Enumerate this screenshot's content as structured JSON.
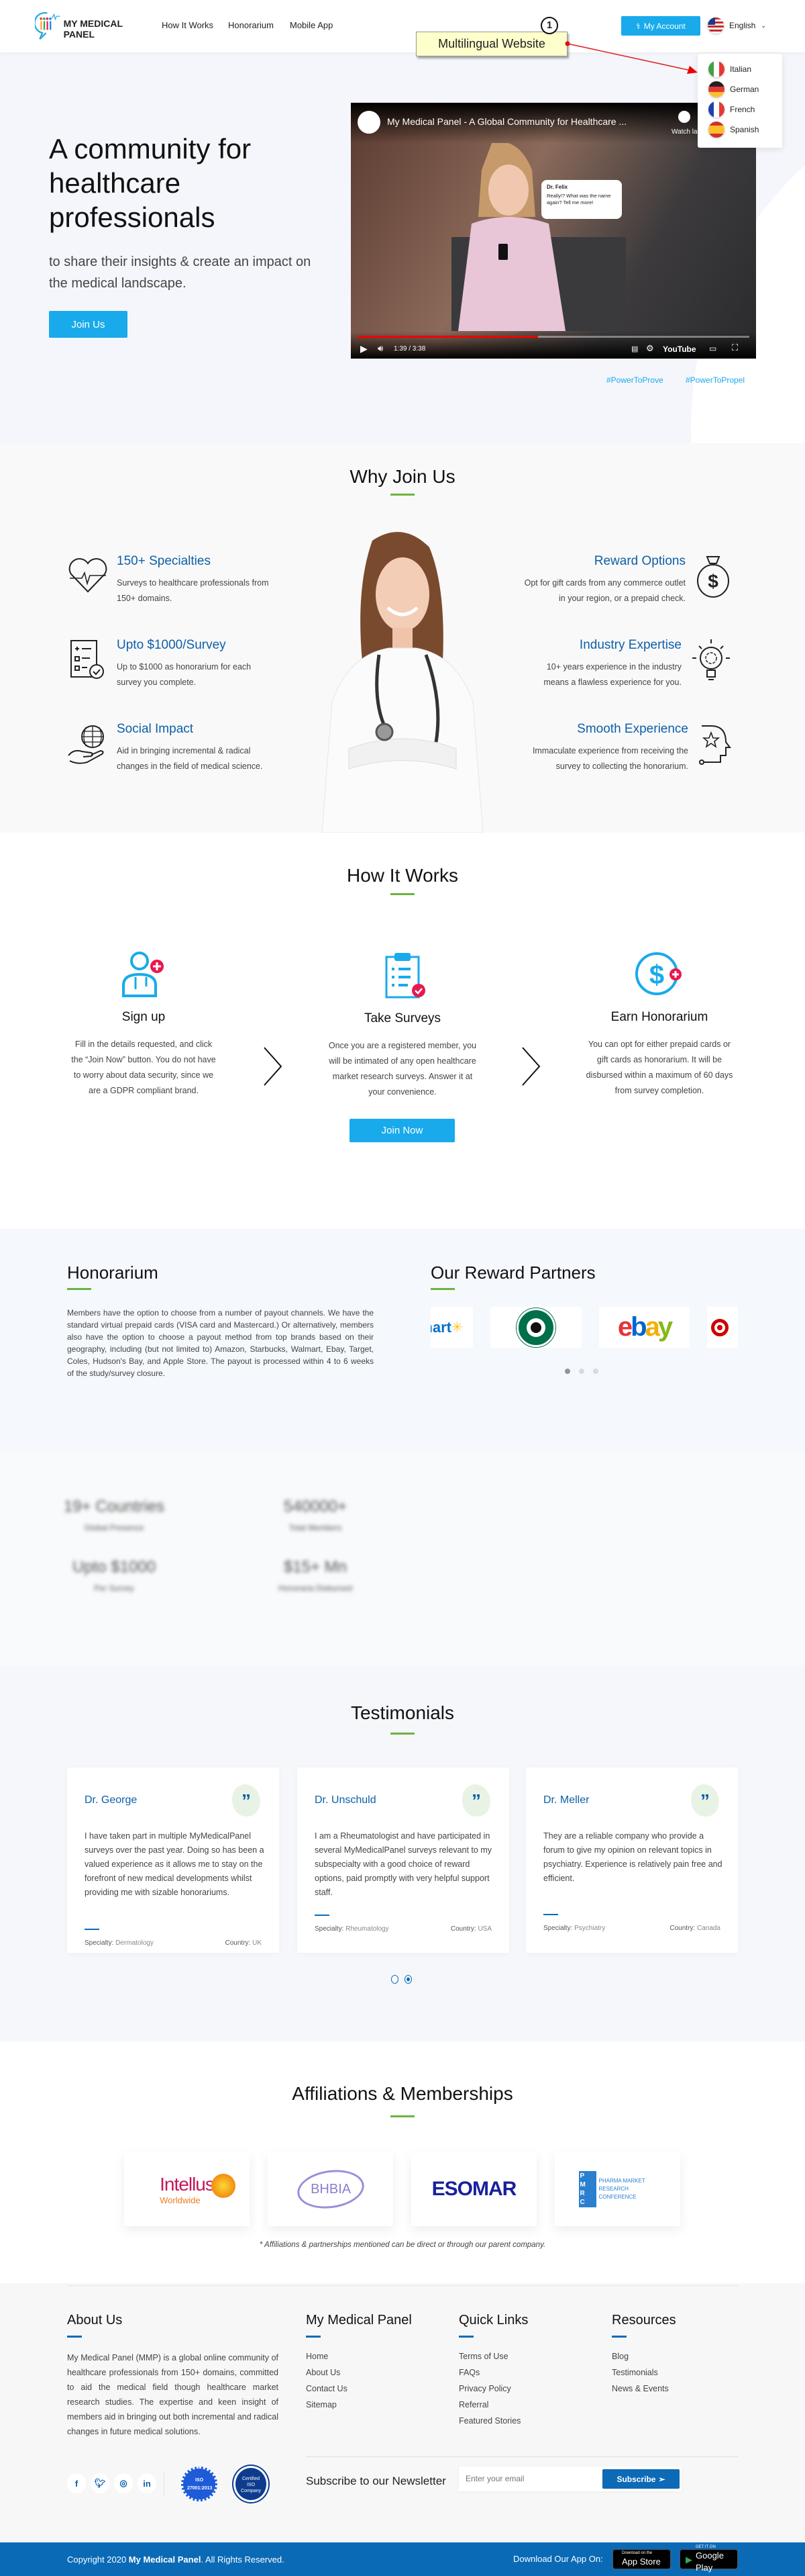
{
  "header": {
    "logo_text": "MY MEDICAL PANEL",
    "nav": [
      "How It Works",
      "Honorarium",
      "Mobile App"
    ],
    "account_button": "My Account",
    "account_icon": "stethoscope-icon",
    "language": {
      "selected": "English",
      "options": [
        "Italian",
        "German",
        "French",
        "Spanish"
      ]
    }
  },
  "annotation": {
    "number": "1",
    "label": "Multilingual Website"
  },
  "hero": {
    "title": "A community for healthcare professionals",
    "subtitle": "to share their insights & create an impact on the medical landscape.",
    "cta": "Join Us",
    "video": {
      "title": "My Medical Panel - A Global Community for Healthcare ...",
      "watch_later": "Watch later",
      "bubble_name": "Dr. Felix",
      "bubble_text": "Really!? What was the name again? Tell me more!",
      "time": "1:39 / 3:38",
      "progress": 0.46,
      "brand": "YouTube"
    },
    "hashtags": [
      "#PowerToProve",
      "#PowerToPropel"
    ]
  },
  "why_join": {
    "title": "Why Join Us",
    "left": [
      {
        "icon": "heart-pulse-icon",
        "title": "150+ Specialties",
        "text": "Surveys to healthcare professionals from 150+ domains."
      },
      {
        "icon": "checklist-icon",
        "title": "Upto $1000/Survey",
        "text": "Up to $1000 as honorarium for each survey you complete."
      },
      {
        "icon": "globe-hand-icon",
        "title": "Social Impact",
        "text": "Aid in bringing incremental & radical changes in the field of medical science."
      }
    ],
    "right": [
      {
        "icon": "money-bag-icon",
        "title": "Reward Options",
        "text": "Opt for gift cards from any commerce outlet in your region, or a prepaid check."
      },
      {
        "icon": "lightbulb-gear-icon",
        "title": "Industry Expertise",
        "text": "10+ years experience in the industry means a flawless experience for you."
      },
      {
        "icon": "head-star-icon",
        "title": "Smooth Experience",
        "text": "Immaculate experience from receiving the survey to collecting the honorarium."
      }
    ]
  },
  "how_it_works": {
    "title": "How It Works",
    "steps": [
      {
        "icon": "doctor-plus-icon",
        "title": "Sign up",
        "text": "Fill in the details requested, and click the “Join Now” button. You do not have to worry about data security, since we are a GDPR compliant brand."
      },
      {
        "icon": "clipboard-check-icon",
        "title": "Take Surveys",
        "text": "Once you are a registered member, you will be intimated of any open healthcare market research surveys. Answer it at your convenience."
      },
      {
        "icon": "dollar-plus-icon",
        "title": "Earn Honorarium",
        "text": "You can opt for either prepaid cards or gift cards as honorarium. It will be disbursed within a maximum of 60 days from survey completion."
      }
    ],
    "cta": "Join Now"
  },
  "honorarium": {
    "title": "Honorarium",
    "text": "Members have the option to choose from a number of payout channels. We have the standard virtual prepaid cards (VISA card and Mastercard.) Or alternatively, members also have the option to choose a payout method from top brands based on their geography, including (but not limited to) Amazon, Starbucks, Walmart, Ebay, Target, Coles, Hudson's Bay, and Apple Store. The payout is processed within 4 to 6 weeks of the study/survey closure."
  },
  "partners": {
    "title": "Our Reward Partners",
    "logos": [
      "Walmart",
      "Starbucks Coffee",
      "ebay",
      "Target"
    ],
    "carousel_active": 1,
    "carousel_count": 3
  },
  "stats": [
    {
      "value": "19+ Countries",
      "label": "Global Presence"
    },
    {
      "value": "540000+",
      "label": "Total Members"
    },
    {
      "value": "Upto $1000",
      "label": "Per Survey"
    },
    {
      "value": "$15+ Mn",
      "label": "Honoraria Disbursed"
    }
  ],
  "testimonials": {
    "title": "Testimonials",
    "specialty_label": "Specialty:",
    "country_label": "Country:",
    "items": [
      {
        "name": "Dr. George",
        "text": "I have taken part in multiple MyMedicalPanel surveys over the past year. Doing so has been a valued experience as it allows me to stay on the forefront of new medical developments whilst providing me with sizable honorariums.",
        "specialty": "Dermatology",
        "country": "UK"
      },
      {
        "name": "Dr. Unschuld",
        "text": "I am a Rheumatologist and have participated in several MyMedicalPanel surveys relevant to my subspecialty with a good choice of reward options, paid promptly with very helpful support staff.",
        "specialty": "Rheumatology",
        "country": "USA"
      },
      {
        "name": "Dr. Meller",
        "text": "They are a reliable company who provide a forum to give my opinion on relevant topics in psychiatry. Experience is relatively pain free and efficient.",
        "specialty": "Psychiatry",
        "country": "Canada"
      }
    ],
    "carousel_active": 2,
    "carousel_count": 2
  },
  "affiliations": {
    "title": "Affiliations & Memberships",
    "logos": [
      {
        "name": "Intellus",
        "sub": "Worldwide"
      },
      {
        "name": "BHBIA"
      },
      {
        "name": "ESOMAR"
      },
      {
        "name": "PMRC",
        "sub": "PHARMA MARKET RESEARCH CONFERENCE"
      }
    ],
    "note": "* Affiliations & partnerships mentioned can be direct or through our parent company."
  },
  "footer": {
    "about": {
      "title": "About Us",
      "text": "My Medical Panel (MMP) is a global online community of healthcare professionals from 150+ domains, committed to aid the medical field though healthcare market research studies. The expertise and keen insight of members aid in bringing out both incremental and radical changes in future medical solutions."
    },
    "columns": [
      {
        "title": "My Medical Panel",
        "links": [
          "Home",
          "About Us",
          "Contact Us",
          "Sitemap"
        ]
      },
      {
        "title": "Quick Links",
        "links": [
          "Terms of Use",
          "FAQs",
          "Privacy Policy",
          "Referral",
          "Featured Stories"
        ]
      },
      {
        "title": "Resources",
        "links": [
          "Blog",
          "Testimonials",
          "News & Events"
        ]
      }
    ],
    "social": [
      "facebook-icon",
      "twitter-icon",
      "instagram-icon",
      "linkedin-icon"
    ],
    "badges": [
      "ISO 27001:2013",
      "Certified ISO Company"
    ],
    "newsletter": {
      "label": "Subscribe to our Newsletter",
      "placeholder": "Enter your email",
      "button": "Subscribe"
    },
    "copyright_prefix": "Copyright 2020 ",
    "copyright_brand": "My Medical Panel",
    "copyright_suffix": ". All Rights Reserved.",
    "download_label": "Download Our App On:",
    "app_store": {
      "small": "Download on the",
      "big": "App Store"
    },
    "google_play": {
      "small": "GET IT ON",
      "big": "Google Play"
    }
  },
  "colors": {
    "primary": "#19aaeb",
    "heading_blue": "#0d5fa8",
    "accent_green": "#6cb33f",
    "footer_bar": "#0a6ab6",
    "alert_red": "#e8184f"
  }
}
